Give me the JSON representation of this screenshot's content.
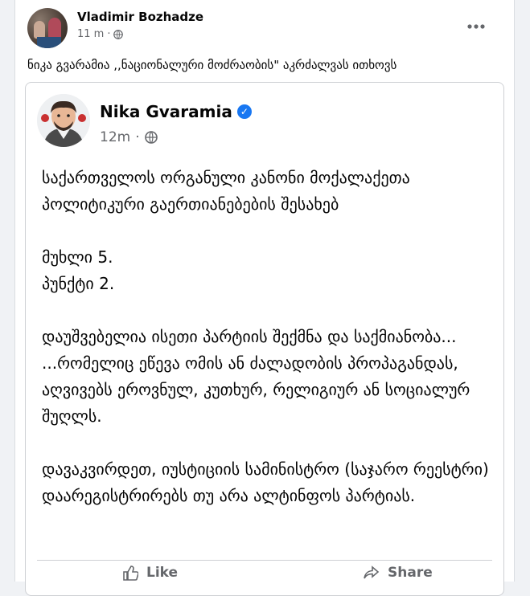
{
  "outer_post": {
    "author": "Vladimir Bozhadze",
    "time": "11 m",
    "privacy_icon": "globe-icon",
    "more_icon": "more-horizontal-icon",
    "text": "ნიკა გვარამია ,,ნაციონალური მოძრაობის\" აკრძალვას ითხოვს"
  },
  "shared_post": {
    "author": "Nika Gvaramia",
    "verified_icon": "verified-badge-icon",
    "time": "12m",
    "privacy_icon": "globe-icon",
    "paragraphs": [
      "საქართველოს ორგანული კანონი მოქალაქეთა პოლიტიკური გაერთიანებების შესახებ",
      "მუხლი 5.\nპუნქტი 2.",
      "დაუშვებელია ისეთი პარტიის შექმნა და საქმიანობა... ...რომელიც ეწევა ომის ან ძალადობის პროპაგანდას, აღვივებს ეროვნულ, კუთხურ, რელიგიურ ან სოციალურ შუღლს.",
      "დავაკვირდეთ, იუსტიციის სამინისტრო (საჯარო რეესტრი) დაარეგისტრირებს თუ არა ალტინფოს პარტიას."
    ],
    "actions": [
      "Like",
      "Share"
    ]
  },
  "colors": {
    "verified": "#1877f2",
    "meta_text": "#65676b",
    "border": "#ced0d4"
  }
}
